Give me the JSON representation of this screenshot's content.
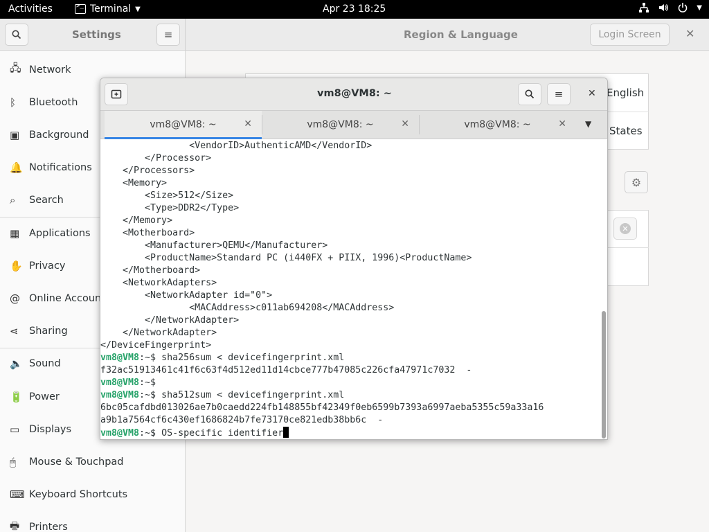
{
  "topbar": {
    "activities": "Activities",
    "app_name": "Terminal",
    "clock": "Apr 23  18:25"
  },
  "settings": {
    "sidebar_title": "Settings",
    "main_title": "Region & Language",
    "login_screen": "Login Screen",
    "sidebar_items": [
      {
        "label": "Network",
        "icon": "network-icon"
      },
      {
        "label": "Bluetooth",
        "icon": "bluetooth-icon"
      },
      {
        "label": "Background",
        "icon": "background-icon"
      },
      {
        "label": "Notifications",
        "icon": "bell-icon"
      },
      {
        "label": "Search",
        "icon": "search-icon"
      },
      {
        "label": "Applications",
        "icon": "applications-icon"
      },
      {
        "label": "Privacy",
        "icon": "hand-icon"
      },
      {
        "label": "Online Accounts",
        "icon": "at-icon"
      },
      {
        "label": "Sharing",
        "icon": "share-icon"
      },
      {
        "label": "Sound",
        "icon": "speaker-icon"
      },
      {
        "label": "Power",
        "icon": "power-icon"
      },
      {
        "label": "Displays",
        "icon": "display-icon"
      },
      {
        "label": "Mouse & Touchpad",
        "icon": "mouse-icon"
      },
      {
        "label": "Keyboard Shortcuts",
        "icon": "keyboard-icon"
      },
      {
        "label": "Printers",
        "icon": "printer-icon"
      }
    ],
    "language_value": "English",
    "formats_value": "States"
  },
  "terminal": {
    "title": "vm8@VM8: ~",
    "tabs": [
      {
        "label": "vm8@VM8: ~"
      },
      {
        "label": "vm8@VM8: ~"
      },
      {
        "label": "vm8@VM8: ~"
      }
    ],
    "lines": [
      "                <VendorID>AuthenticAMD</VendorID>",
      "        </Processor>",
      "    </Processors>",
      "    <Memory>",
      "        <Size>512</Size>",
      "        <Type>DDR2</Type>",
      "    </Memory>",
      "    <Motherboard>",
      "        <Manufacturer>QEMU</Manufacturer>",
      "        <ProductName>Standard PC (i440FX + PIIX, 1996)<ProductName>",
      "    </Motherboard>",
      "    <NetworkAdapters>",
      "        <NetworkAdapter id=\"0\">",
      "                <MACAddress>c011ab694208</MACAddress>",
      "        </NetworkAdapter>",
      "    </NetworkAdapter>",
      "</DeviceFingerprint>"
    ],
    "prompt_user": "vm8@VM8",
    "prompt_sep": ":~$ ",
    "cmd1": "sha256sum < devicefingerprint.xml",
    "out1": "f32ac51913461c41f6c63f4d512ed11d14cbce777b47085c226cfa47971c7032  -",
    "cmd2": "",
    "cmd3": "sha512sum < devicefingerprint.xml",
    "out3a": "6bc05cafdbd013026ae7b0caedd224fb148855bf42349f0eb6599b7393a6997aeba5355c59a33a16",
    "out3b": "a9b1a7564cf6c430ef1686824b7fe73170ce821edb38bb6c  -",
    "cmd4": "OS-specific identifier"
  }
}
